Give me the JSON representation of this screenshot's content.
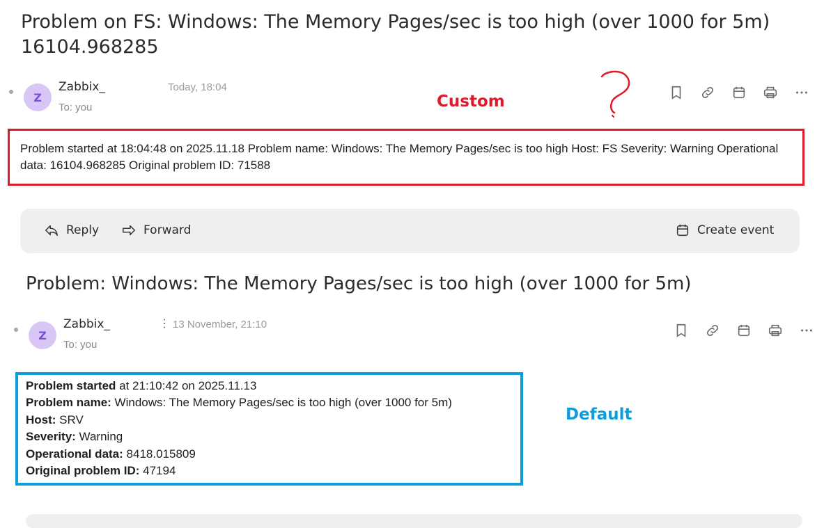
{
  "email1": {
    "subject": "Problem on FS: Windows: The Memory Pages/sec is too high (over 1000 for 5m) 16104.968285",
    "avatar_letter": "Z",
    "sender": "Zabbix_",
    "time": "Today, 18:04",
    "to": "To: you",
    "body": "Problem started at 18:04:48 on 2025.11.18 Problem name: Windows: The Memory Pages/sec is too high Host: FS Severity: Warning Operational data: 16104.968285 Original problem ID: 71588"
  },
  "annotations": {
    "custom_label": "Custom",
    "default_label": "Default",
    "custom_color": "#e01a2a",
    "default_color": "#0d9ddb"
  },
  "actions": {
    "reply": "Reply",
    "forward": "Forward",
    "create_event": "Create event"
  },
  "toolbar_icons": [
    "bookmark-icon",
    "link-icon",
    "calendar-icon",
    "print-icon",
    "more-icon"
  ],
  "email2": {
    "subject": "Problem: Windows: The Memory Pages/sec is too high (over 1000 for 5m)",
    "avatar_letter": "Z",
    "sender": "Zabbix_",
    "kebab": "⋮",
    "time": "13 November, 21:10",
    "to": "To: you",
    "body": {
      "l1_label": "Problem started",
      "l1_value": " at 21:10:42 on 2025.11.13",
      "l2_label": "Problem name:",
      "l2_value": " Windows: The Memory Pages/sec is too high (over 1000 for 5m)",
      "l3_label": "Host:",
      "l3_value": " SRV",
      "l4_label": "Severity:",
      "l4_value": " Warning",
      "l5_label": "Operational data:",
      "l5_value": " 8418.015809",
      "l6_label": "Original problem ID:",
      "l6_value": " 47194"
    }
  }
}
